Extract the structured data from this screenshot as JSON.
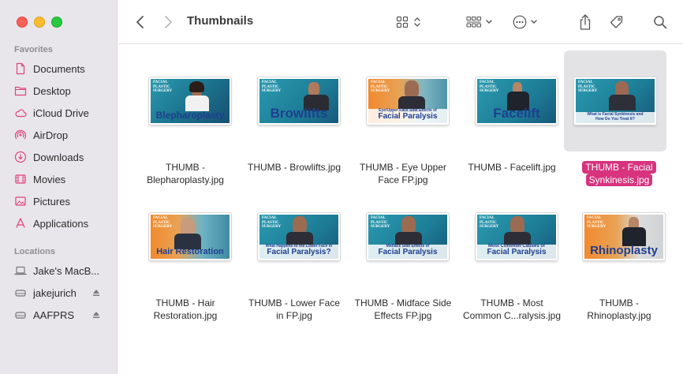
{
  "window": {
    "title": "Thumbnails"
  },
  "sidebar": {
    "favorites_label": "Favorites",
    "favorites": [
      {
        "label": "Documents",
        "icon": "document-icon"
      },
      {
        "label": "Desktop",
        "icon": "folder-icon"
      },
      {
        "label": "iCloud Drive",
        "icon": "cloud-icon"
      },
      {
        "label": "AirDrop",
        "icon": "airdrop-icon"
      },
      {
        "label": "Downloads",
        "icon": "download-icon"
      },
      {
        "label": "Movies",
        "icon": "film-icon"
      },
      {
        "label": "Pictures",
        "icon": "photo-icon"
      },
      {
        "label": "Applications",
        "icon": "applications-icon"
      }
    ],
    "locations_label": "Locations",
    "locations": [
      {
        "label": "Jake's MacB...",
        "icon": "laptop-icon"
      },
      {
        "label": "jakejurich",
        "icon": "drive-icon"
      },
      {
        "label": "AAFPRS",
        "icon": "drive-icon"
      }
    ]
  },
  "files": [
    {
      "line1": "THUMB -",
      "line2": "Blepharoplasty.jpg",
      "caption": "Blepharoplasty",
      "subcaption": "",
      "selected": false
    },
    {
      "line1": "THUMB - Browlifts.jpg",
      "line2": "",
      "caption": "Browlifts",
      "subcaption": "",
      "selected": false
    },
    {
      "line1": "THUMB - Eye Upper",
      "line2": "Face FP.jpg",
      "caption": "Facial Paralysis",
      "subcaption": "Eye/Upper Face Side Effects of",
      "selected": false
    },
    {
      "line1": "THUMB - Facelift.jpg",
      "line2": "",
      "caption": "Facelift",
      "subcaption": "",
      "selected": false
    },
    {
      "line1": "THUMB - Facial",
      "line2": "Synkinesis.jpg",
      "caption": "",
      "subcaption": "What is Facial Synkinesis and How Do You Treat It?",
      "selected": true
    },
    {
      "line1": "THUMB - Hair",
      "line2": "Restoration.jpg",
      "caption": "Hair Restoration",
      "subcaption": "",
      "selected": false
    },
    {
      "line1": "THUMB - Lower Face",
      "line2": "in FP.jpg",
      "caption": "Facial Paralysis?",
      "subcaption": "What Happens to the Lower Face in",
      "selected": false
    },
    {
      "line1": "THUMB - Midface Side",
      "line2": "Effects FP.jpg",
      "caption": "Facial Paralysis",
      "subcaption": "Midface Side Effects of",
      "selected": false
    },
    {
      "line1": "THUMB - Most",
      "line2": "Common C...ralysis.jpg",
      "caption": "Facial Paralysis",
      "subcaption": "Most Common Causes of",
      "selected": false
    },
    {
      "line1": "THUMB -",
      "line2": "Rhinoplasty.jpg",
      "caption": "Rhinoplasty",
      "subcaption": "",
      "selected": false
    }
  ],
  "thumb_logo": "FACIAL PLASTIC SURGERY",
  "colors": {
    "selection": "#d7337f",
    "sidebar_bg": "#e8e6ea",
    "sidebar_icon": "#e0447a",
    "caption_blue": "#1e3f8f"
  }
}
